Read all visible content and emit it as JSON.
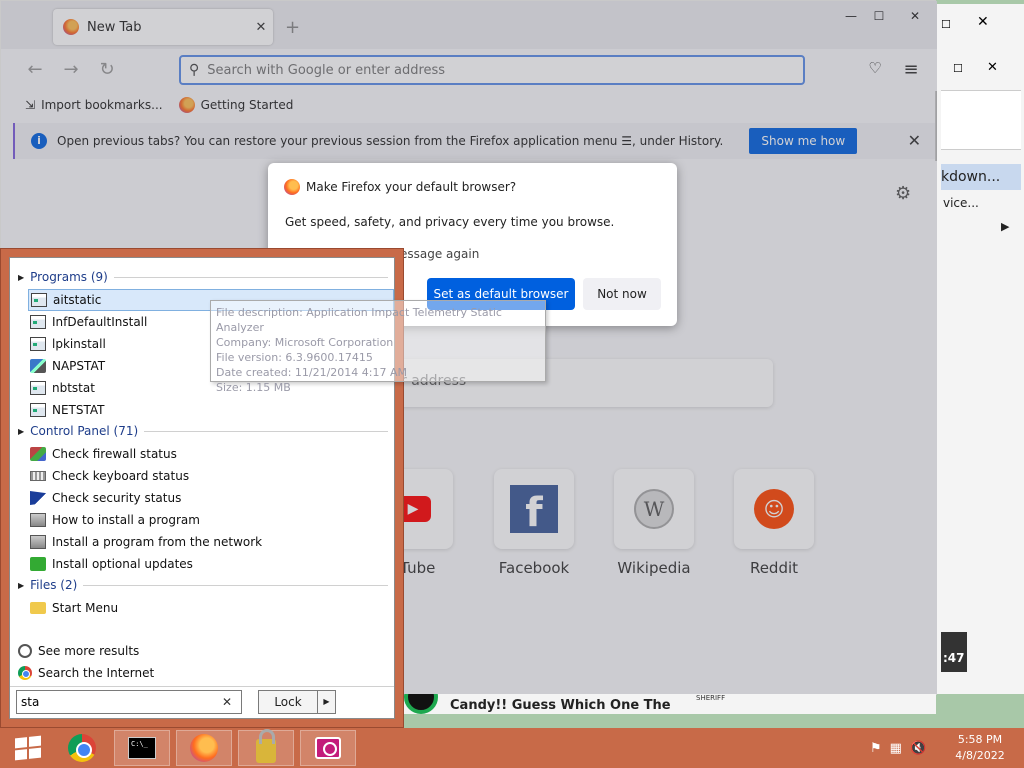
{
  "firefox": {
    "tab_title": "New Tab",
    "new_tab_symbol": "+",
    "window_controls": {
      "minimize": "—",
      "maximize": "☐",
      "close": "✕"
    },
    "nav": {
      "back": "←",
      "forward": "→",
      "reload": "↻",
      "pocket": "♡",
      "menu": "≡"
    },
    "url_placeholder": "Search with Google or enter address",
    "bookmarks": [
      {
        "label": "Import bookmarks...",
        "icon": "import-icon"
      },
      {
        "label": "Getting Started",
        "icon": "firefox-icon"
      }
    ],
    "notification": {
      "bold": "Open previous tabs?",
      "text": "You can restore your previous session from the Firefox application menu ☰, under History.",
      "button": "Show me how",
      "close": "✕"
    },
    "content_search_tail": "r address",
    "top_sites": [
      {
        "label": "uTube",
        "icon": "youtube-icon"
      },
      {
        "label": "Facebook",
        "icon": "facebook-icon"
      },
      {
        "label": "Wikipedia",
        "icon": "wikipedia-icon"
      },
      {
        "label": "Reddit",
        "icon": "reddit-icon"
      }
    ],
    "news_headline": "Candy!! Guess Which One The",
    "news_small": "SHERIFF"
  },
  "dialog": {
    "title": "Make Firefox your default browser?",
    "body": "Get speed, safety, and privacy every time you browse.",
    "checkbox_tail": "essage again",
    "primary": "Set as default browser",
    "secondary": "Not now"
  },
  "tooltip": {
    "lines": [
      "File description: Application Impact Telemetry Static Analyzer",
      "Company: Microsoft Corporation",
      "File version: 6.3.9600.17415",
      "Date created: 11/21/2014 4:17 AM",
      "Size: 1.15 MB"
    ]
  },
  "start_menu": {
    "groups": [
      {
        "header": "Programs (9)",
        "items": [
          {
            "label": "aitstatic",
            "icon": "program-icon",
            "selected": true
          },
          {
            "label": "InfDefaultInstall",
            "icon": "program-icon"
          },
          {
            "label": "lpkinstall",
            "icon": "program-icon"
          },
          {
            "label": "NAPSTAT",
            "icon": "network-icon"
          },
          {
            "label": "nbtstat",
            "icon": "program-icon"
          },
          {
            "label": "NETSTAT",
            "icon": "program-icon"
          }
        ]
      },
      {
        "header": "Control Panel (71)",
        "items": [
          {
            "label": "Check firewall status",
            "icon": "firewall-icon"
          },
          {
            "label": "Check keyboard status",
            "icon": "keyboard-icon"
          },
          {
            "label": "Check security status",
            "icon": "flag-icon"
          },
          {
            "label": "How to install a program",
            "icon": "install-icon"
          },
          {
            "label": "Install a program from the network",
            "icon": "install-icon"
          },
          {
            "label": "Install optional updates",
            "icon": "update-icon"
          }
        ]
      },
      {
        "header": "Files (2)",
        "items": [
          {
            "label": "Start Menu",
            "icon": "folder-icon"
          }
        ]
      }
    ],
    "see_more": "See more results",
    "search_internet": "Search the Internet",
    "search_value": "sta",
    "search_clear": "✕",
    "lock_label": "Lock",
    "lock_arrow": "▶"
  },
  "background_window": {
    "tab_text": "kdown...",
    "sub_text": "vice...",
    "arrow": "▶",
    "time_text": ":47"
  },
  "taskbar": {
    "apps": [
      "windows-start",
      "chrome",
      "command-prompt",
      "firefox",
      "lock-app",
      "camera-app"
    ],
    "clock_time": "5:58 PM",
    "clock_date": "4/8/2022"
  }
}
